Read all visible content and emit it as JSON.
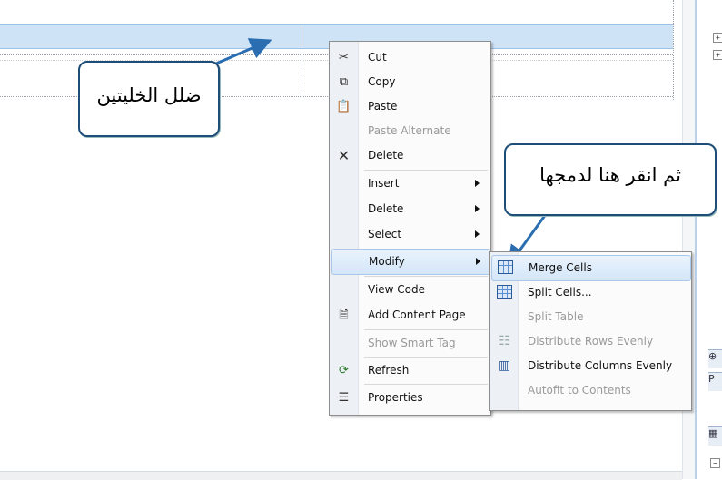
{
  "callouts": {
    "select_cells": "ضلل الخليتين",
    "click_here": "ثم انقر هنا لدمجها"
  },
  "context_menu": {
    "items": [
      {
        "label": "Cut",
        "icon": "scissors-icon",
        "disabled": false
      },
      {
        "label": "Copy",
        "icon": "copy-icon",
        "disabled": false
      },
      {
        "label": "Paste",
        "icon": "paste-icon",
        "disabled": false
      },
      {
        "label": "Paste Alternate",
        "icon": "",
        "disabled": true
      },
      {
        "label": "Delete",
        "icon": "x-icon",
        "disabled": false
      },
      {
        "label": "Insert",
        "submenu": true
      },
      {
        "label": "Delete",
        "submenu": true
      },
      {
        "label": "Select",
        "submenu": true
      },
      {
        "label": "Modify",
        "submenu": true,
        "highlighted": true
      },
      {
        "label": "View Code",
        "disabled": false
      },
      {
        "label": "Add Content Page",
        "icon": "add-page-icon",
        "disabled": false
      },
      {
        "label": "Show Smart Tag",
        "disabled": true
      },
      {
        "label": "Refresh",
        "icon": "refresh-icon",
        "disabled": false
      },
      {
        "label": "Properties",
        "icon": "properties-icon",
        "disabled": false
      }
    ]
  },
  "modify_submenu": {
    "items": [
      {
        "label": "Merge Cells",
        "icon": "merge-cells-icon",
        "highlighted": true
      },
      {
        "label": "Split Cells...",
        "icon": "split-cells-icon"
      },
      {
        "label": "Split Table",
        "disabled": true
      },
      {
        "label": "Distribute Rows Evenly",
        "icon": "distribute-rows-icon",
        "disabled": true
      },
      {
        "label": "Distribute Columns Evenly",
        "icon": "distribute-columns-icon"
      },
      {
        "label": "Autofit to Contents",
        "disabled": true
      }
    ]
  },
  "right_panel": {
    "label_p": "P"
  },
  "colors": {
    "selection": "#cfe3f7",
    "callout_border": "#1e4d78",
    "arrow": "#2a6db0"
  }
}
